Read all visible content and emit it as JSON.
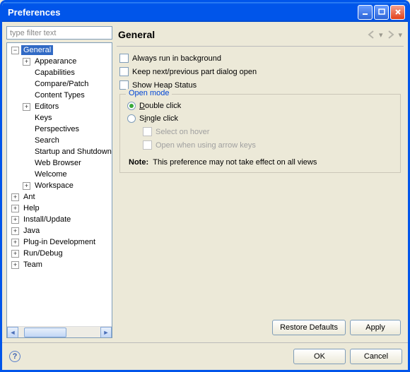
{
  "window": {
    "title": "Preferences"
  },
  "filter": {
    "placeholder": "type filter text"
  },
  "tree": {
    "general": "General",
    "general_children": [
      "Appearance",
      "Capabilities",
      "Compare/Patch",
      "Content Types",
      "Editors",
      "Keys",
      "Perspectives",
      "Search",
      "Startup and Shutdown",
      "Web Browser",
      "Welcome",
      "Workspace"
    ],
    "roots": [
      "Ant",
      "Help",
      "Install/Update",
      "Java",
      "Plug-in Development",
      "Run/Debug",
      "Team"
    ]
  },
  "header": {
    "title": "General"
  },
  "options": {
    "bg": "Always run in background",
    "keep": "Keep next/previous part dialog open",
    "heap": "Show Heap Status"
  },
  "open_mode": {
    "group": "Open mode",
    "double": "Double click",
    "single": "Single click",
    "hover": "Select on hover",
    "arrow": "Open when using arrow keys",
    "note_label": "Note:",
    "note_text": "This preference may not take effect on all views"
  },
  "buttons": {
    "restore": "Restore Defaults",
    "apply": "Apply",
    "ok": "OK",
    "cancel": "Cancel"
  }
}
